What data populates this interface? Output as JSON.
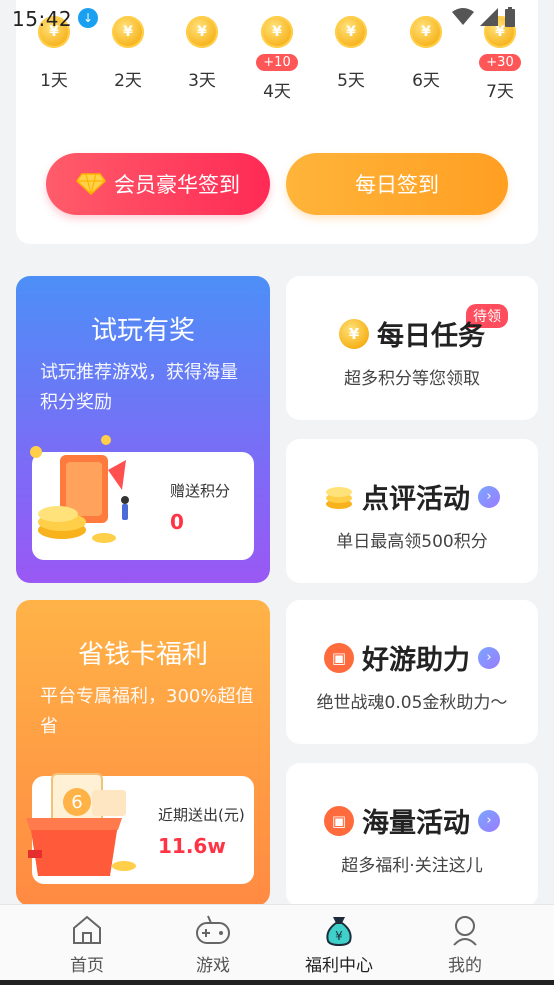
{
  "status": {
    "time": "15:42"
  },
  "signin": {
    "days": [
      {
        "label": "1天",
        "bonus": ""
      },
      {
        "label": "2天",
        "bonus": ""
      },
      {
        "label": "3天",
        "bonus": ""
      },
      {
        "label": "4天",
        "bonus": "+10"
      },
      {
        "label": "5天",
        "bonus": ""
      },
      {
        "label": "6天",
        "bonus": ""
      },
      {
        "label": "7天",
        "bonus": "+30"
      }
    ],
    "coin_symbol": "¥",
    "vip_button": "会员豪华签到",
    "daily_button": "每日签到"
  },
  "trial": {
    "title": "试玩有奖",
    "desc": "试玩推荐游戏，获得海量积分奖励",
    "points_label": "赠送积分",
    "points_value": "0"
  },
  "saver": {
    "title": "省钱卡福利",
    "desc": "平台专属福利，300%超值省",
    "sent_label": "近期送出(元)",
    "sent_value": "11.6w",
    "ticket_text": "6"
  },
  "tasks": [
    {
      "title": "每日任务",
      "sub": "超多积分等您领取",
      "tag": "待领"
    },
    {
      "title": "点评活动",
      "sub": "单日最高领500积分"
    },
    {
      "title": "好游助力",
      "sub": "绝世战魂0.05金秋助力～"
    },
    {
      "title": "海量活动",
      "sub": "超多福利·关注这儿"
    }
  ],
  "nav": [
    {
      "label": "首页",
      "icon": "home-icon"
    },
    {
      "label": "游戏",
      "icon": "gamepad-icon"
    },
    {
      "label": "福利中心",
      "icon": "money-bag-icon",
      "active": true
    },
    {
      "label": "我的",
      "icon": "profile-icon"
    }
  ],
  "colors": {
    "vip": "#ff2a55",
    "daily": "#ffa326",
    "trial_top": "#4d8ff7",
    "trial_bottom": "#9a58f4",
    "saver_top": "#ffb347",
    "saver_bottom": "#ff8a42",
    "accent_red": "#ff3344"
  }
}
